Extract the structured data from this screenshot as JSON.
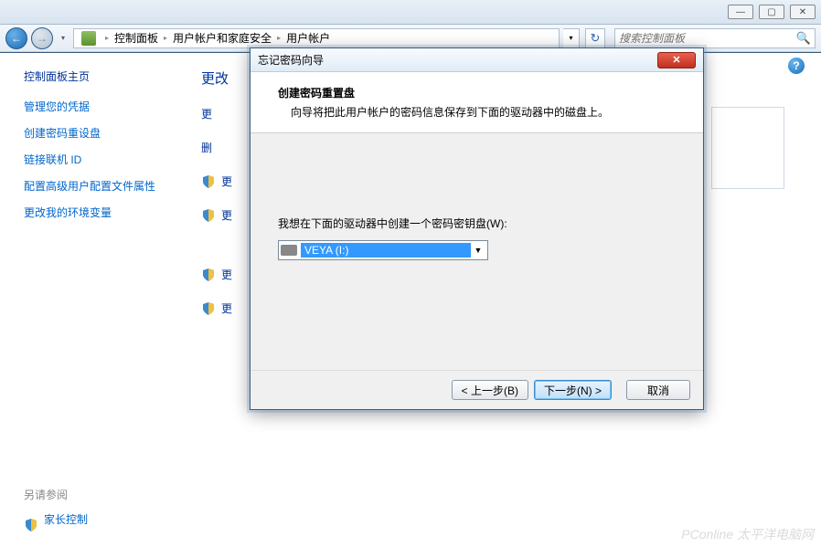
{
  "window": {
    "minimize": "―",
    "maximize": "▢",
    "close": "✕"
  },
  "nav": {
    "back": "←",
    "forward": "→",
    "refresh": "↻",
    "search_icon": "🔍"
  },
  "breadcrumbs": {
    "items": [
      "控制面板",
      "用户帐户和家庭安全",
      "用户帐户"
    ],
    "sep": "▸"
  },
  "search": {
    "placeholder": "搜索控制面板"
  },
  "sidebar": {
    "heading": "控制面板主页",
    "links": [
      "管理您的凭据",
      "创建密码重设盘",
      "链接联机 ID",
      "配置高级用户配置文件属性",
      "更改我的环境变量"
    ],
    "also_heading": "另请参阅",
    "also_link": "家长控制"
  },
  "content": {
    "title": "更改",
    "items": [
      "更",
      "删",
      "更",
      "更",
      "更",
      "更"
    ]
  },
  "help": "?",
  "wizard": {
    "title": "忘记密码向导",
    "close": "✕",
    "heading": "创建密码重置盘",
    "desc": "向导将把此用户帐户的密码信息保存到下面的驱动器中的磁盘上。",
    "prompt": "我想在下面的驱动器中创建一个密码密钥盘(W):",
    "drive": "VEYA (I:)",
    "buttons": {
      "back": "< 上一步(B)",
      "next": "下一步(N) >",
      "cancel": "取消"
    }
  },
  "watermark": "PConline 太平洋电脑网"
}
